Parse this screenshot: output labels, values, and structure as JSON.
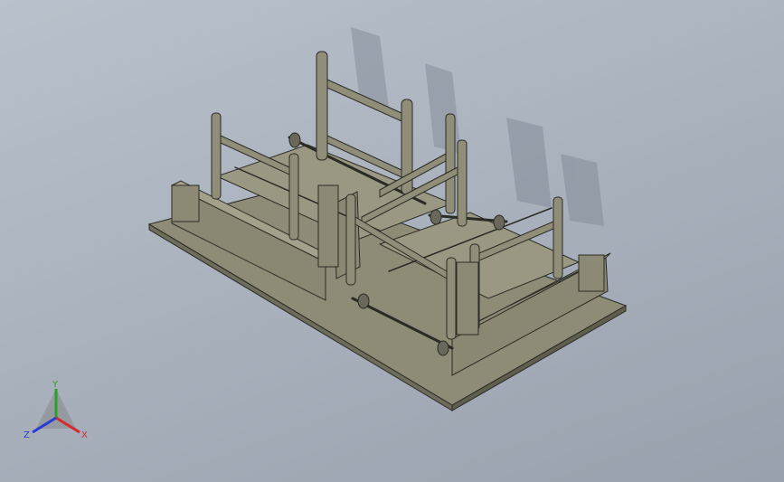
{
  "viewport": {
    "background_top": "#b9c1cc",
    "background_bottom": "#98a1ad"
  },
  "model": {
    "part_color": "#8c8a74",
    "edge_color": "#2b2b25",
    "shadow_color": "#7f8894"
  },
  "triad": {
    "x_label": "X",
    "y_label": "Y",
    "z_label": "Z",
    "x_color": "#d42a2a",
    "y_color": "#2aa02a",
    "z_color": "#2a3ad4"
  }
}
